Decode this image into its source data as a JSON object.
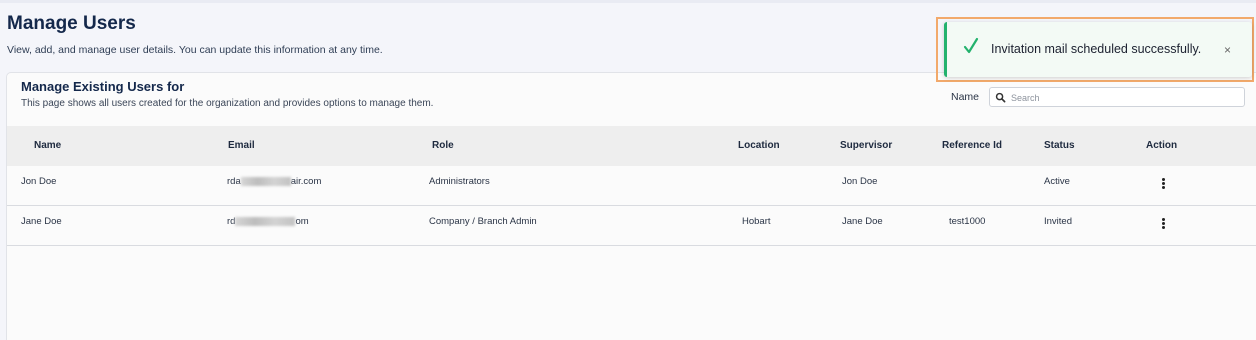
{
  "header": {
    "title": "Manage Users",
    "subtitle": "View, add, and manage user details. You can update this information at any time."
  },
  "card": {
    "title": "Manage Existing Users for",
    "subtitle": "This page shows all users created for the organization and provides options to manage them."
  },
  "filter": {
    "label": "Name",
    "placeholder": "Search"
  },
  "table": {
    "columns": [
      "Name",
      "Email",
      "Role",
      "Location",
      "Supervisor",
      "Reference Id",
      "Status",
      "Action"
    ],
    "rows": [
      {
        "name": "Jon Doe",
        "email_prefix": "rda",
        "email_suffix": "air.com",
        "role": "Administrators",
        "location": "",
        "supervisor": "Jon Doe",
        "reference_id": "",
        "status": "Active"
      },
      {
        "name": "Jane Doe",
        "email_prefix": "rd",
        "email_suffix": "om",
        "role": "Company / Branch Admin",
        "location": "Hobart",
        "supervisor": "Jane Doe",
        "reference_id": "test1000",
        "status": "Invited"
      }
    ]
  },
  "toast": {
    "message": "Invitation mail scheduled successfully.",
    "close_symbol": "×",
    "icon": "check-icon",
    "accent_color": "#23b26d"
  },
  "icons": {
    "search": "search-icon",
    "row_action": "more-vertical-icon"
  }
}
